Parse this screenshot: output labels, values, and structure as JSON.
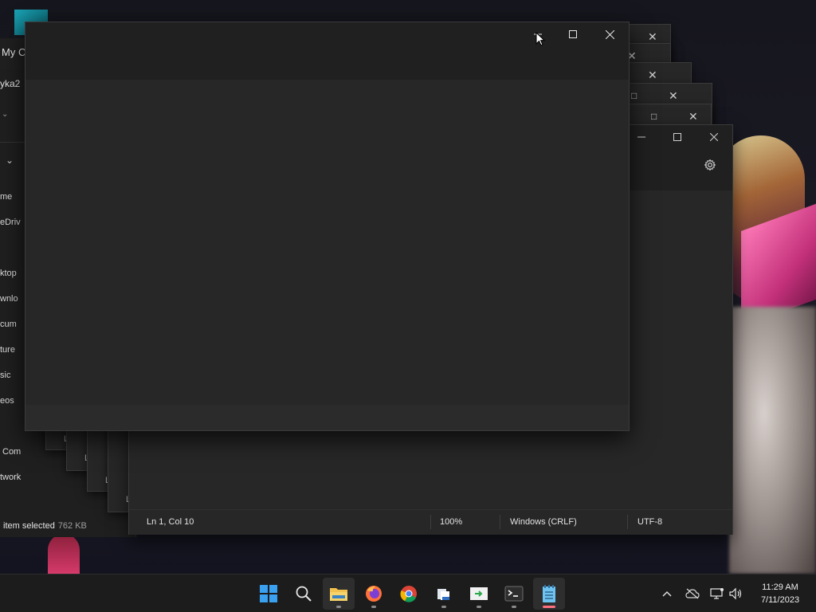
{
  "explorer": {
    "title": "My C",
    "address": "yka2",
    "nav_items": [
      "me",
      "eDriv",
      "ktop",
      "wnlo",
      "cum",
      "ture",
      "sic",
      "eos",
      "Com",
      "twork"
    ],
    "status_text": "item selected",
    "status_size": "762 KB"
  },
  "stack_labels": [
    "L",
    "L",
    "L",
    "L"
  ],
  "notepad": {
    "status": {
      "position": "Ln 1, Col 10",
      "zoom": "100%",
      "line_ending": "Windows (CRLF)",
      "encoding": "UTF-8"
    }
  },
  "taskbar": {
    "apps": [
      "start",
      "search",
      "file-explorer",
      "firefox",
      "chrome",
      "files",
      "remote-desktop",
      "terminal",
      "notepad"
    ],
    "time": "11:29 AM",
    "date": "7/11/2023"
  },
  "colors": {
    "window_bg": "#272727",
    "titlebar_bg": "#202020",
    "taskbar_bg": "#1c1c1c",
    "accent_indicator": "#ff6f7f"
  }
}
